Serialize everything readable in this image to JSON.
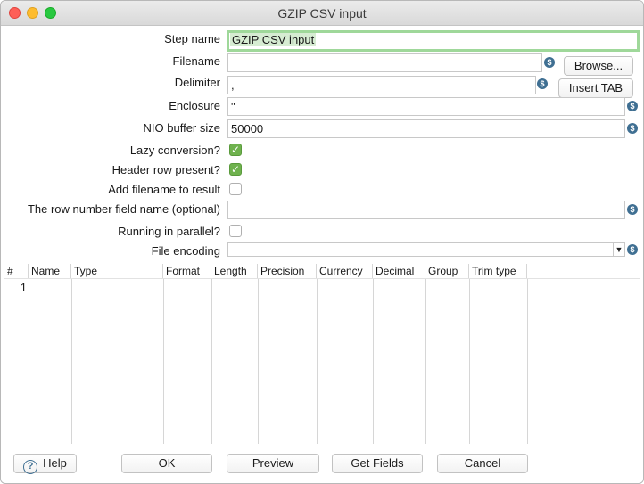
{
  "window": {
    "title": "GZIP CSV input"
  },
  "form": {
    "step_name": {
      "label": "Step name",
      "value": "GZIP CSV input"
    },
    "filename": {
      "label": "Filename",
      "value": "",
      "browse_label": "Browse..."
    },
    "delimiter": {
      "label": "Delimiter",
      "value": ",",
      "insert_tab_label": "Insert TAB"
    },
    "enclosure": {
      "label": "Enclosure",
      "value": "\""
    },
    "nio_buffer_size": {
      "label": "NIO buffer size",
      "value": "50000"
    },
    "lazy_conversion": {
      "label": "Lazy conversion?",
      "checked": true
    },
    "header_row_present": {
      "label": "Header row present?",
      "checked": true
    },
    "add_filename_to_result": {
      "label": "Add filename to result",
      "checked": false
    },
    "row_number_field": {
      "label": "The row number field name (optional)",
      "value": ""
    },
    "running_in_parallel": {
      "label": "Running in parallel?",
      "checked": false
    },
    "file_encoding": {
      "label": "File encoding",
      "value": ""
    }
  },
  "table": {
    "columns": [
      "#",
      "Name",
      "Type",
      "Format",
      "Length",
      "Precision",
      "Currency",
      "Decimal",
      "Group",
      "Trim type"
    ],
    "rows": [
      {
        "num": "1"
      }
    ]
  },
  "buttons": {
    "help": "Help",
    "ok": "OK",
    "preview": "Preview",
    "get_fields": "Get Fields",
    "cancel": "Cancel"
  },
  "icons": {
    "variable": "variable-dollar-icon",
    "help": "help-question-icon",
    "checkmark": "check-icon"
  },
  "colors": {
    "focus_ring": "#9fd89a",
    "checkbox_checked": "#6fb24e",
    "variable_icon": "#3f6f92"
  }
}
